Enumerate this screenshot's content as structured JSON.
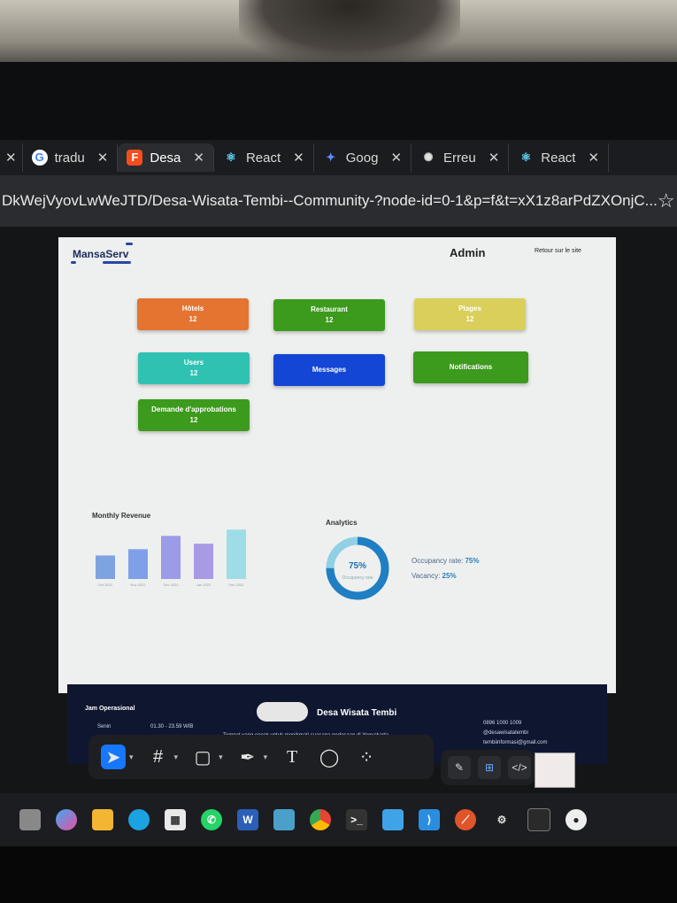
{
  "browser": {
    "tabs": [
      {
        "label": "",
        "icon": "close-icon"
      },
      {
        "label": "tradu",
        "icon": "google-icon"
      },
      {
        "label": "Desa",
        "icon": "figma-icon",
        "active": true
      },
      {
        "label": "React",
        "icon": "react-icon"
      },
      {
        "label": "Goog",
        "icon": "gemini-icon"
      },
      {
        "label": "Erreu",
        "icon": "chatgpt-icon"
      },
      {
        "label": "React",
        "icon": "react-icon"
      }
    ],
    "url": "DkWejVyovLwWeJTD/Desa-Wisata-Tembi--Community-?node-id=0-1&p=f&t=xX1z8arPdZXOnjC..."
  },
  "dashboard": {
    "logo": "MansaServ",
    "header_title": "Admin",
    "back_link": "Retour sur le site",
    "cards": [
      {
        "label": "Hôtels",
        "count": "12",
        "color": "#e4742f"
      },
      {
        "label": "Restaurant",
        "count": "12",
        "color": "#3c9a1c"
      },
      {
        "label": "Plages",
        "count": "12",
        "color": "#d9cf5a"
      },
      {
        "label": "Users",
        "count": "12",
        "color": "#2fc2b3"
      },
      {
        "label": "Messages",
        "count": "",
        "color": "#1446d6"
      },
      {
        "label": "Notifications",
        "count": "",
        "color": "#3c9a1c"
      },
      {
        "label": "Demande d'approbations",
        "count": "12",
        "color": "#3c9a1c"
      }
    ],
    "revenue_title": "Monthly Revenue",
    "analytics_title": "Analytics",
    "donut_value": "75%",
    "donut_caption": "Occupancy rate",
    "occupancy_label": "Occupancy rate:",
    "occupancy_value": "75%",
    "vacancy_label": "Vacancy:",
    "vacancy_value": "25%"
  },
  "chart_data": {
    "type": "bar",
    "title": "Monthly Revenue",
    "categories": [
      "Oct 2022",
      "Nov 2022",
      "Dec 2022",
      "Jan 2022",
      "Feb 2022"
    ],
    "values": [
      30,
      38,
      55,
      45,
      63
    ],
    "colors": [
      "#7fa3e0",
      "#7f9fe8",
      "#9b9be8",
      "#a89ae4",
      "#9fdde6"
    ],
    "ylim": [
      0,
      70
    ]
  },
  "footer": {
    "hours_title": "Jam Operasional",
    "day": "Senin",
    "time": "01.30 - 23.59 WIB",
    "brand": "Desa Wisata Tembi",
    "tagline": "Tempat yang cocok untuk menikmati suasana pedesaan di Yogyakarta",
    "phone": "0896 1000 1009",
    "social": "@desawisatatembi",
    "email": "tembiinformasi@gmail.com"
  },
  "figma_toolbar": {
    "tools": [
      "move-tool",
      "frame-tool",
      "shape-tool",
      "pen-tool",
      "text-tool",
      "comment-tool",
      "actions-tool"
    ],
    "text_tool_label": "T"
  }
}
